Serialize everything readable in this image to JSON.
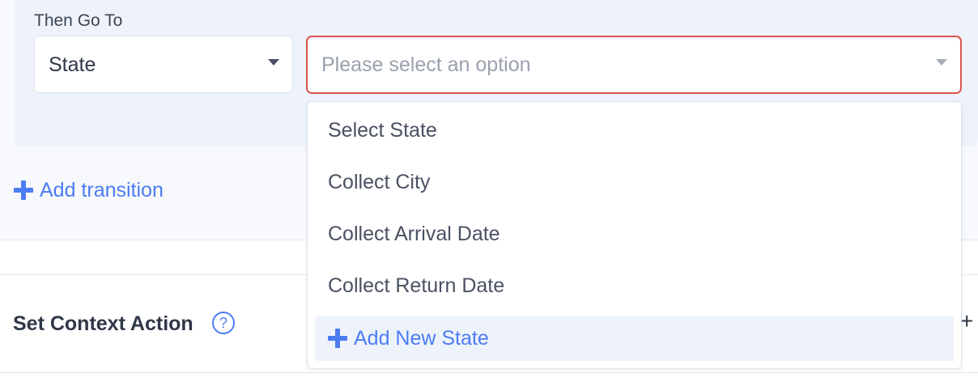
{
  "transition": {
    "then_go_to_label": "Then Go To",
    "type_select": {
      "value": "State"
    },
    "target_select": {
      "placeholder": "Please select an option",
      "options": [
        "Select State",
        "Collect City",
        "Collect Arrival Date",
        "Collect Return Date"
      ],
      "add_new_label": "Add New State"
    },
    "add_transition_label": "Add transition"
  },
  "context_action": {
    "label": "Set Context Action",
    "help_icon": "?",
    "add_icon": "+"
  },
  "colors": {
    "accent": "#4c7cf3",
    "error_border": "#d9534f",
    "text": "#2f3747",
    "placeholder": "#9aa1ad"
  },
  "icons": {
    "caret": "chevron-down-icon",
    "plus": "plus-icon",
    "help": "question-circle-icon"
  }
}
